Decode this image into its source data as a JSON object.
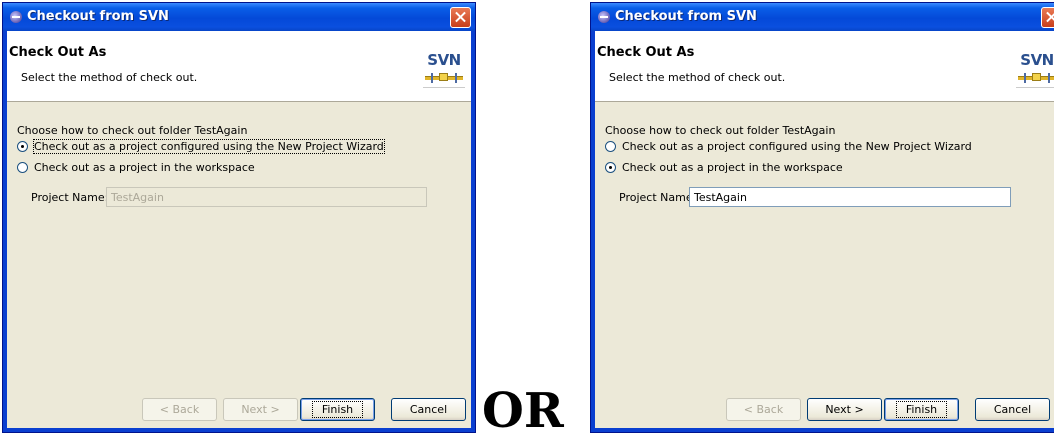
{
  "dialogs": [
    {
      "title": "Checkout from SVN",
      "banner_title": "Check Out As",
      "banner_desc": "Select the method of check out.",
      "logo_text": "SVN",
      "choose_label": "Choose how to check out folder TestAgain",
      "option1": "Check out as a project configured using the New Project Wizard",
      "option2": "Check out as a project in the workspace",
      "selected_option": 1,
      "project_name_label": "Project Name:",
      "project_name_value": "TestAgain",
      "project_name_enabled": false,
      "buttons": {
        "back": "< Back",
        "next": "Next >",
        "finish": "Finish",
        "cancel": "Cancel"
      },
      "back_enabled": false,
      "next_enabled": false
    },
    {
      "title": "Checkout from SVN",
      "banner_title": "Check Out As",
      "banner_desc": "Select the method of check out.",
      "logo_text": "SVN",
      "choose_label": "Choose how to check out folder TestAgain",
      "option1": "Check out as a project configured using the New Project Wizard",
      "option2": "Check out as a project in the workspace",
      "selected_option": 2,
      "project_name_label": "Project Name:",
      "project_name_value": "TestAgain",
      "project_name_enabled": true,
      "buttons": {
        "back": "< Back",
        "next": "Next >",
        "finish": "Finish",
        "cancel": "Cancel"
      },
      "back_enabled": false,
      "next_enabled": true
    }
  ],
  "separator_text": "OR",
  "colors": {
    "titlebar": "#0a5ee8",
    "dialog_bg": "#ece9d8",
    "close_button": "#c83e1b"
  }
}
